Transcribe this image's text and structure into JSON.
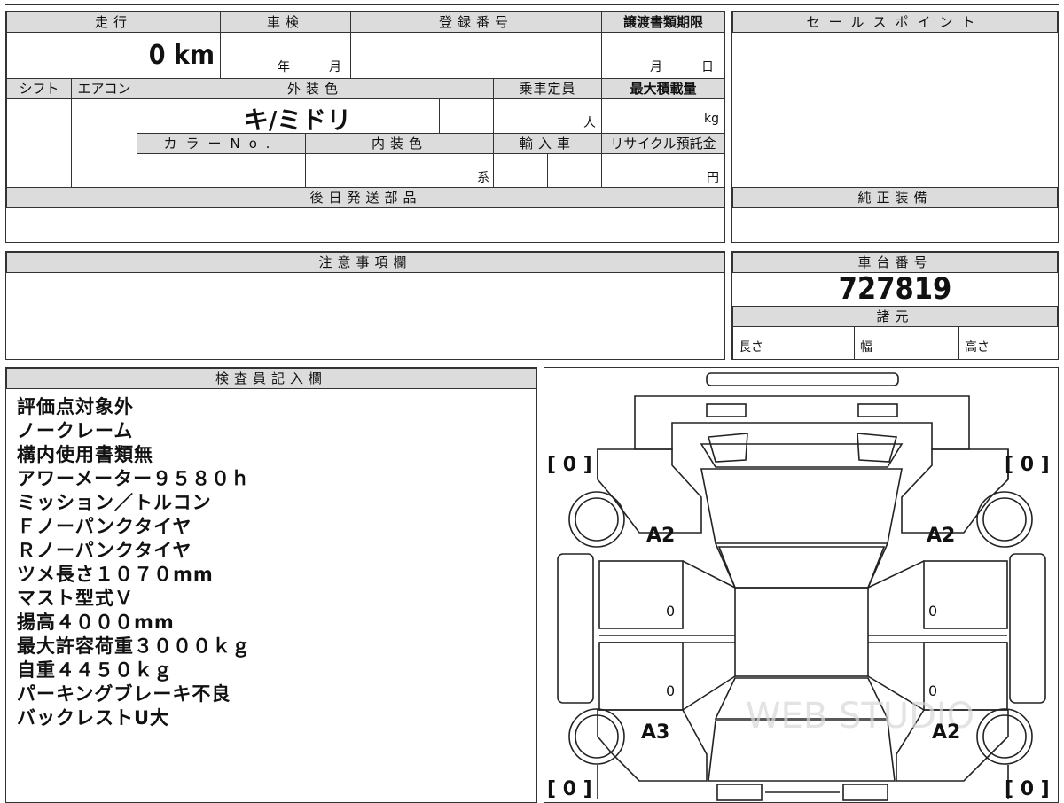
{
  "top_table": {
    "mileage_label": "走行",
    "mileage_value": "0 km",
    "inspection_label": "車検",
    "inspection_year": "年",
    "inspection_month": "月",
    "registration_label": "登録番号",
    "transfer_label": "譲渡書類期限",
    "transfer_month": "月",
    "transfer_day": "日",
    "shift_label": "シフト",
    "aircon_label": "エアコン",
    "exterior_color_label": "外装色",
    "exterior_color_value": "キ/ミドリ",
    "capacity_label": "乗車定員",
    "capacity_unit": "人",
    "max_load_label": "最大積載量",
    "max_load_unit": "kg",
    "color_no_label": "カラーNo.",
    "interior_color_label": "内装色",
    "interior_suffix": "系",
    "import_label": "輸入車",
    "recycle_label": "リサイクル預託金",
    "recycle_unit": "円",
    "later_parts_label": "後日発送部品"
  },
  "right_panel": {
    "sales_point_label": "セールスポイント",
    "genuine_equipment_label": "純正装備",
    "chassis_number_label": "車台番号",
    "chassis_number_value": "727819",
    "specs_label": "諸元",
    "length_label": "長さ",
    "width_label": "幅",
    "height_label": "高さ"
  },
  "notes": {
    "label": "注意事項欄"
  },
  "inspector": {
    "label": "検査員記入欄",
    "lines": [
      "評価点対象外",
      "ノークレーム",
      "構内使用書類無",
      "アワーメーター９５８０ｈ",
      "ミッション／トルコン",
      "Ｆノーパンクタイヤ",
      "Ｒノーパンクタイヤ",
      "ツメ長さ１０７０mm",
      "マスト型式Ｖ",
      "揚高４０００mm",
      "最大許容荷重３０００ｋｇ",
      "自重４４５０ｋｇ",
      "パーキングブレーキ不良",
      "バックレストU大"
    ]
  },
  "diagram": {
    "tl_bracket": "[ 0 ]",
    "tr_bracket": "[ 0 ]",
    "bl_bracket": "[ 0 ]",
    "br_bracket": "[ 0 ]",
    "mark_front_left": "A2",
    "mark_front_right": "A2",
    "mark_rear_left": "A3",
    "mark_rear_right": "A2",
    "door_fl": "0",
    "door_fr": "0",
    "door_rl": "0",
    "door_rr": "0",
    "watermark": "WEB STUDIO"
  }
}
